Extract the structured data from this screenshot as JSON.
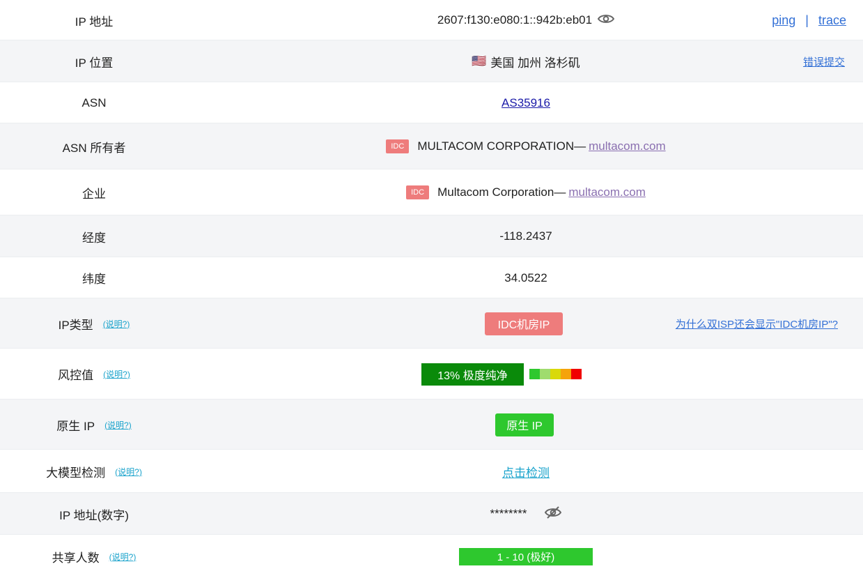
{
  "rows": {
    "ip": {
      "label": "IP 地址",
      "value": "2607:f130:e080:1::942b:eb01",
      "ping": "ping",
      "separator": "|",
      "trace": "trace"
    },
    "location": {
      "label": "IP 位置",
      "flag": "🇺🇸",
      "value": "美国 加州 洛杉矶",
      "report": "错误提交"
    },
    "asn": {
      "label": "ASN",
      "value": "AS35916"
    },
    "asn_owner": {
      "label": "ASN 所有者",
      "tag": "IDC",
      "name": "MULTACOM CORPORATION— ",
      "site": "multacom.com"
    },
    "company": {
      "label": "企业",
      "tag": "IDC",
      "name": "Multacom Corporation— ",
      "site": "multacom.com"
    },
    "longitude": {
      "label": "经度",
      "value": "-118.2437"
    },
    "latitude": {
      "label": "纬度",
      "value": "34.0522"
    },
    "ip_type": {
      "label": "IP类型",
      "help": "(说明?)",
      "value": "IDC机房IP",
      "why": "为什么双ISP还会显示\"IDC机房IP\"?"
    },
    "risk": {
      "label": "风控值",
      "help": "(说明?)",
      "value": "13%  极度纯净",
      "percent": 13,
      "scale_colors": [
        "#2ec82e",
        "#9fdc6e",
        "#d9d90a",
        "#f5a30a",
        "#f00000"
      ]
    },
    "native": {
      "label": "原生 IP",
      "help": "(说明?)",
      "value": "原生 IP"
    },
    "llm": {
      "label": "大模型检测",
      "help": "(说明?)",
      "value": "点击检测"
    },
    "ip_number": {
      "label": "IP 地址(数字)",
      "value": "********"
    },
    "shared": {
      "label": "共享人数",
      "help": "(说明?)",
      "value": "1 - 10 (极好)"
    }
  },
  "icons": {
    "reveal": "eye-icon",
    "hidden": "eye-off-icon"
  }
}
